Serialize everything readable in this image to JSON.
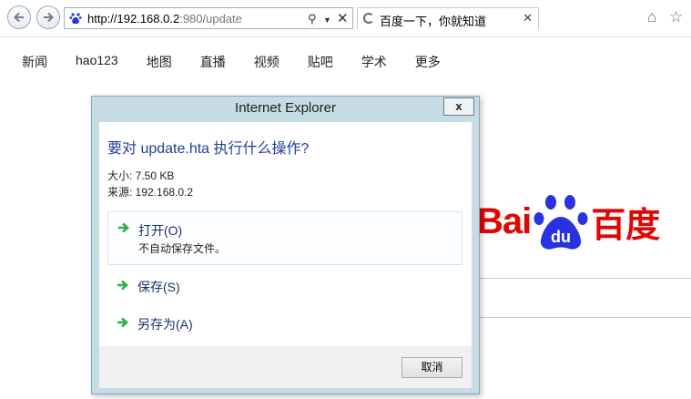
{
  "browser": {
    "url_host": "http://192.168.0.2",
    "url_rest": ":980/update",
    "tab_title": "百度一下，你就知道"
  },
  "page": {
    "nav": [
      "新闻",
      "hao123",
      "地图",
      "直播",
      "视频",
      "贴吧",
      "学术",
      "更多"
    ],
    "logo_text": "Bai",
    "logo_cn": "百度",
    "logo_paw_text": "du"
  },
  "dialog": {
    "title": "Internet Explorer",
    "close_label": "x",
    "question": "要对 update.hta 执行什么操作?",
    "size": "大小: 7.50 KB",
    "source": "来源: 192.168.0.2",
    "open_label": "打开(O)",
    "open_sub": "不自动保存文件。",
    "save_label": "保存(S)",
    "save_as_label": "另存为(A)",
    "cancel_label": "取消"
  },
  "colors": {
    "baidu_red": "#e10601",
    "baidu_blue": "#2932e1",
    "option_arrow": "#2bb24c",
    "dialog_frame": "#c6dbe4"
  }
}
